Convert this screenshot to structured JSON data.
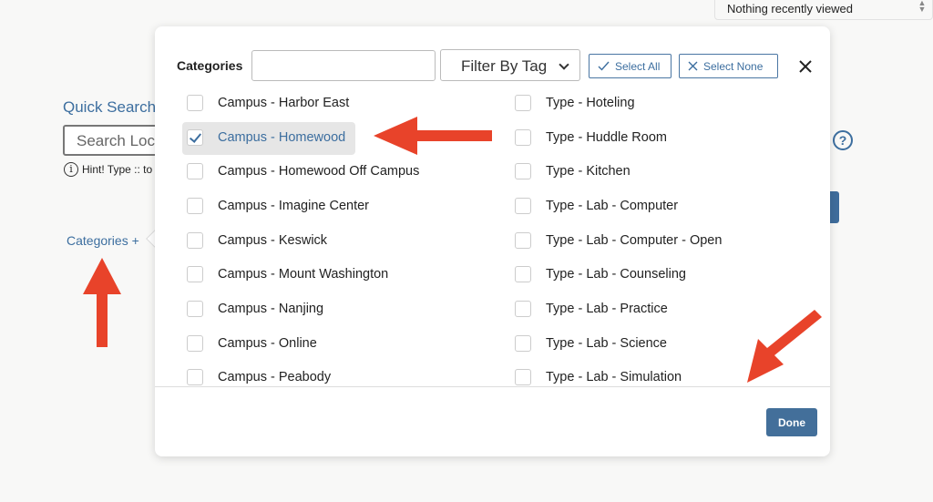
{
  "background": {
    "recently_viewed_select": "Nothing recently viewed",
    "quick_search_title": "Quick Search",
    "search_placeholder": "Search Loca",
    "hint_text": "Hint! Type :: to",
    "categories_link": "Categories +",
    "help_icon": "?"
  },
  "modal": {
    "title": "Categories",
    "filter_input_value": "",
    "filter_by_tag_label": "Filter By Tag",
    "select_all_label": "Select All",
    "select_none_label": "Select None",
    "done_label": "Done",
    "left_column": [
      {
        "label": "Campus - Harbor East",
        "checked": false
      },
      {
        "label": "Campus - Homewood",
        "checked": true
      },
      {
        "label": "Campus - Homewood Off Campus",
        "checked": false
      },
      {
        "label": "Campus - Imagine Center",
        "checked": false
      },
      {
        "label": "Campus - Keswick",
        "checked": false
      },
      {
        "label": "Campus - Mount Washington",
        "checked": false
      },
      {
        "label": "Campus - Nanjing",
        "checked": false
      },
      {
        "label": "Campus - Online",
        "checked": false
      },
      {
        "label": "Campus - Peabody",
        "checked": false
      }
    ],
    "right_column": [
      {
        "label": "Type - Hoteling",
        "checked": false
      },
      {
        "label": "Type - Huddle Room",
        "checked": false
      },
      {
        "label": "Type - Kitchen",
        "checked": false
      },
      {
        "label": "Type - Lab - Computer",
        "checked": false
      },
      {
        "label": "Type - Lab - Computer - Open",
        "checked": false
      },
      {
        "label": "Type - Lab - Counseling",
        "checked": false
      },
      {
        "label": "Type - Lab - Practice",
        "checked": false
      },
      {
        "label": "Type - Lab - Science",
        "checked": false
      },
      {
        "label": "Type - Lab - Simulation",
        "checked": false
      }
    ]
  },
  "annotations": {
    "arrow_color": "#e8432a",
    "accent_color": "#3c6e9f"
  }
}
